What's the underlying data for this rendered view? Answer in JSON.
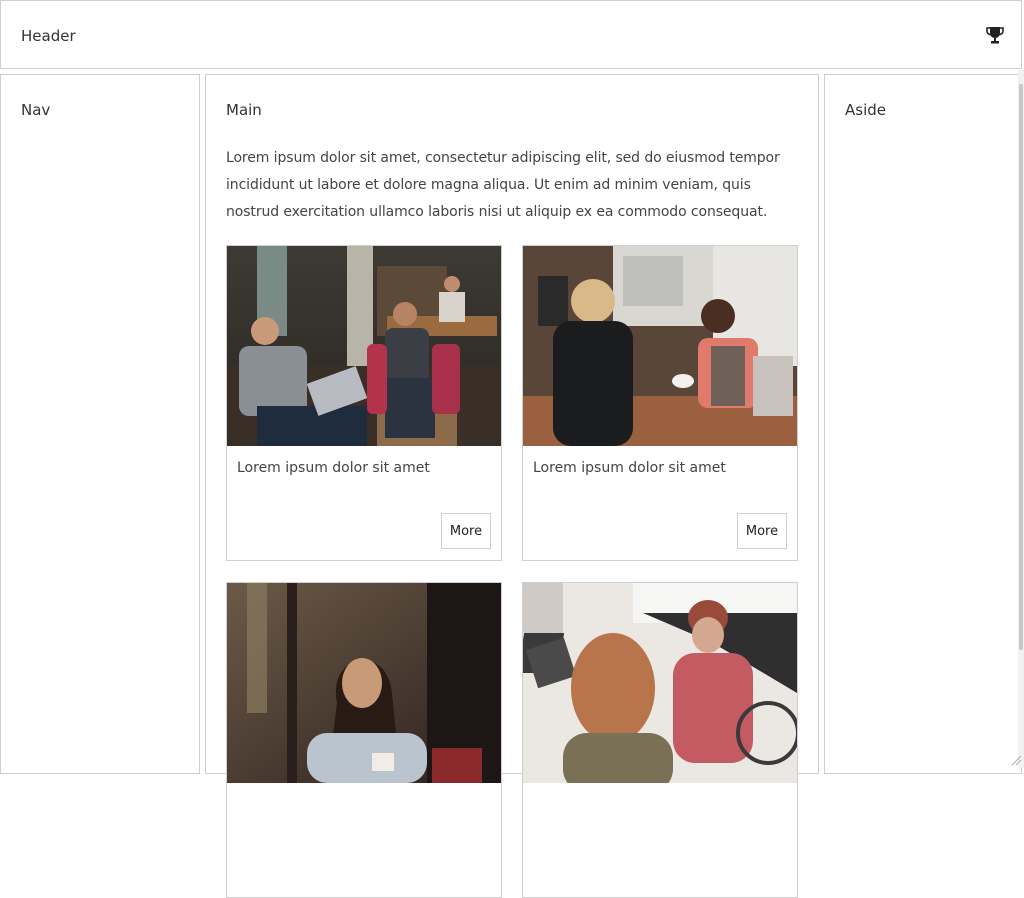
{
  "header": {
    "title": "Header",
    "icon": "trophy-icon"
  },
  "nav": {
    "title": "Nav"
  },
  "main": {
    "title": "Main",
    "intro": "Lorem ipsum dolor sit amet, consectetur adipiscing elit, sed do eiusmod tempor incididunt ut labore et dolore magna aliqua. Ut enim ad minim veniam, quis nostrud exercitation ullamco laboris nisi ut aliquip ex ea commodo consequat.",
    "cards": [
      {
        "text": "Lorem ipsum dolor sit amet",
        "button": "More"
      },
      {
        "text": "Lorem ipsum dolor sit amet",
        "button": "More"
      },
      {
        "text": "",
        "button": ""
      },
      {
        "text": "",
        "button": ""
      }
    ]
  },
  "aside": {
    "title": "Aside"
  },
  "colors": {
    "border": "#cfcfcf",
    "text": "#333333"
  }
}
